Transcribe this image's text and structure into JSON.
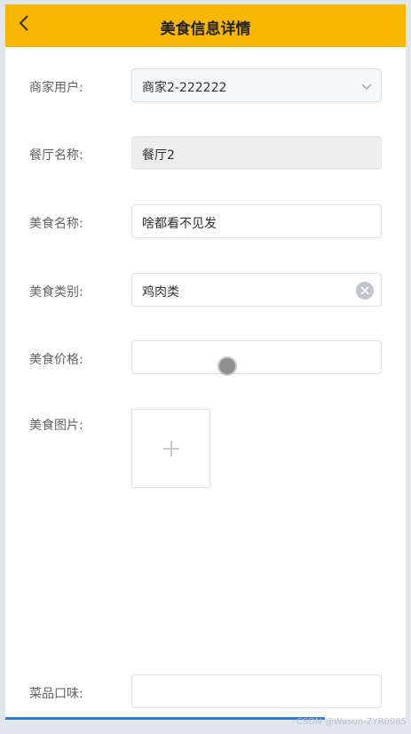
{
  "header": {
    "title": "美食信息详情"
  },
  "form": {
    "merchant_label": "商家用户:",
    "merchant_value": "商家2-222222",
    "restaurant_label": "餐厅名称:",
    "restaurant_value": "餐厅2",
    "food_name_label": "美食名称:",
    "food_name_value": "啥都看不见发",
    "category_label": "美食类别:",
    "category_value": "鸡肉类",
    "price_label": "美食价格:",
    "price_value": "",
    "image_label": "美食图片:",
    "taste_label": "菜品口味:",
    "taste_value": ""
  },
  "watermark": "CSDN @Wasun-ZYR0985"
}
